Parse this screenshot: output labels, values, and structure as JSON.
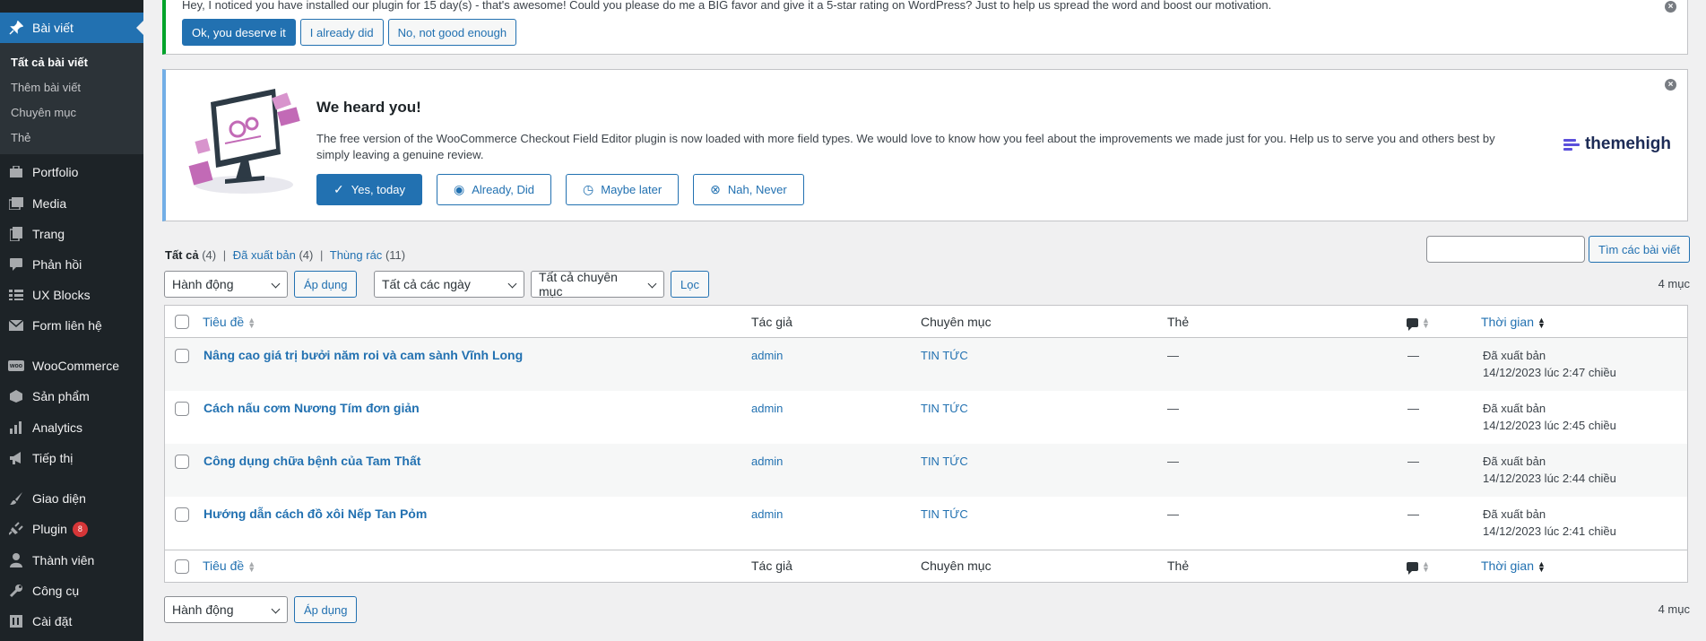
{
  "sidebar": {
    "active": {
      "label": "Bài viết",
      "icon": "pin-icon"
    },
    "submenu": [
      "Tất cả bài viết",
      "Thêm bài viết",
      "Chuyên mục",
      "Thẻ"
    ],
    "items": [
      {
        "label": "Portfolio",
        "icon": "portfolio-icon"
      },
      {
        "label": "Media",
        "icon": "media-icon"
      },
      {
        "label": "Trang",
        "icon": "page-icon"
      },
      {
        "label": "Phản hồi",
        "icon": "comment-icon"
      },
      {
        "label": "UX Blocks",
        "icon": "blocks-icon"
      },
      {
        "label": "Form liên hệ",
        "icon": "mail-icon"
      },
      {
        "label": "WooCommerce",
        "icon": "woocommerce-icon"
      },
      {
        "label": "Sản phẩm",
        "icon": "product-icon"
      },
      {
        "label": "Analytics",
        "icon": "analytics-icon"
      },
      {
        "label": "Tiếp thị",
        "icon": "megaphone-icon"
      },
      {
        "label": "Giao diện",
        "icon": "brush-icon"
      },
      {
        "label": "Plugin",
        "icon": "plugin-icon",
        "badge": "8"
      },
      {
        "label": "Thành viên",
        "icon": "user-icon"
      },
      {
        "label": "Công cụ",
        "icon": "wrench-icon"
      },
      {
        "label": "Cài đặt",
        "icon": "settings-icon"
      }
    ]
  },
  "notice_rating": {
    "text": "Hey, I noticed you have installed our plugin for 15 day(s) - that's awesome! Could you please do me a BIG favor and give it a 5-star rating on WordPress? Just to help us spread the word and boost our motivation.",
    "btn_yes": "Ok, you deserve it",
    "btn_did": "I already did",
    "btn_no": "No, not good enough"
  },
  "notice_review": {
    "title": "We heard you!",
    "description": "The free version of the WooCommerce Checkout Field Editor plugin is now loaded with more field types. We would love to know how you feel about the improvements we made just for you. Help us to serve you and others best by simply leaving a genuine review.",
    "btn_yes": "Yes, today",
    "btn_did": "Already, Did",
    "btn_later": "Maybe later",
    "btn_never": "Nah, Never",
    "brand": "themehigh"
  },
  "views": {
    "all": "Tất cả",
    "all_count": "(4)",
    "published": "Đã xuất bản",
    "published_count": "(4)",
    "trash": "Thùng rác",
    "trash_count": "(11)",
    "sep": "|"
  },
  "search": {
    "button": "Tìm các bài viết",
    "value": ""
  },
  "filters": {
    "bulk_action": "Hành động",
    "apply": "Áp dụng",
    "dates": "Tất cả các ngày",
    "categories": "Tất cả chuyên mục",
    "filter": "Lọc",
    "count": "4 mục"
  },
  "table": {
    "headers": {
      "title": "Tiêu đề",
      "author": "Tác giả",
      "categories": "Chuyên mục",
      "tags": "Thẻ",
      "date": "Thời gian"
    },
    "rows": [
      {
        "title": "Nâng cao giá trị bưởi năm roi và cam sành Vĩnh Long",
        "author": "admin",
        "category": "TIN TỨC",
        "tags": "—",
        "comments": "—",
        "status": "Đã xuất bản",
        "date": "14/12/2023 lúc 2:47 chiều"
      },
      {
        "title": "Cách nấu cơm Nương Tím đơn giản",
        "author": "admin",
        "category": "TIN TỨC",
        "tags": "—",
        "comments": "—",
        "status": "Đã xuất bản",
        "date": "14/12/2023 lúc 2:45 chiều"
      },
      {
        "title": "Công dụng chữa bệnh của Tam Thất",
        "author": "admin",
        "category": "TIN TỨC",
        "tags": "—",
        "comments": "—",
        "status": "Đã xuất bản",
        "date": "14/12/2023 lúc 2:44 chiều"
      },
      {
        "title": "Hướng dẫn cách đồ xôi Nếp Tan Pỏm",
        "author": "admin",
        "category": "TIN TỨC",
        "tags": "—",
        "comments": "—",
        "status": "Đã xuất bản",
        "date": "14/12/2023 lúc 2:41 chiều"
      }
    ]
  },
  "colors": {
    "sidebar": "#1d2327",
    "accent": "#2271b1",
    "badge": "#d63638"
  }
}
